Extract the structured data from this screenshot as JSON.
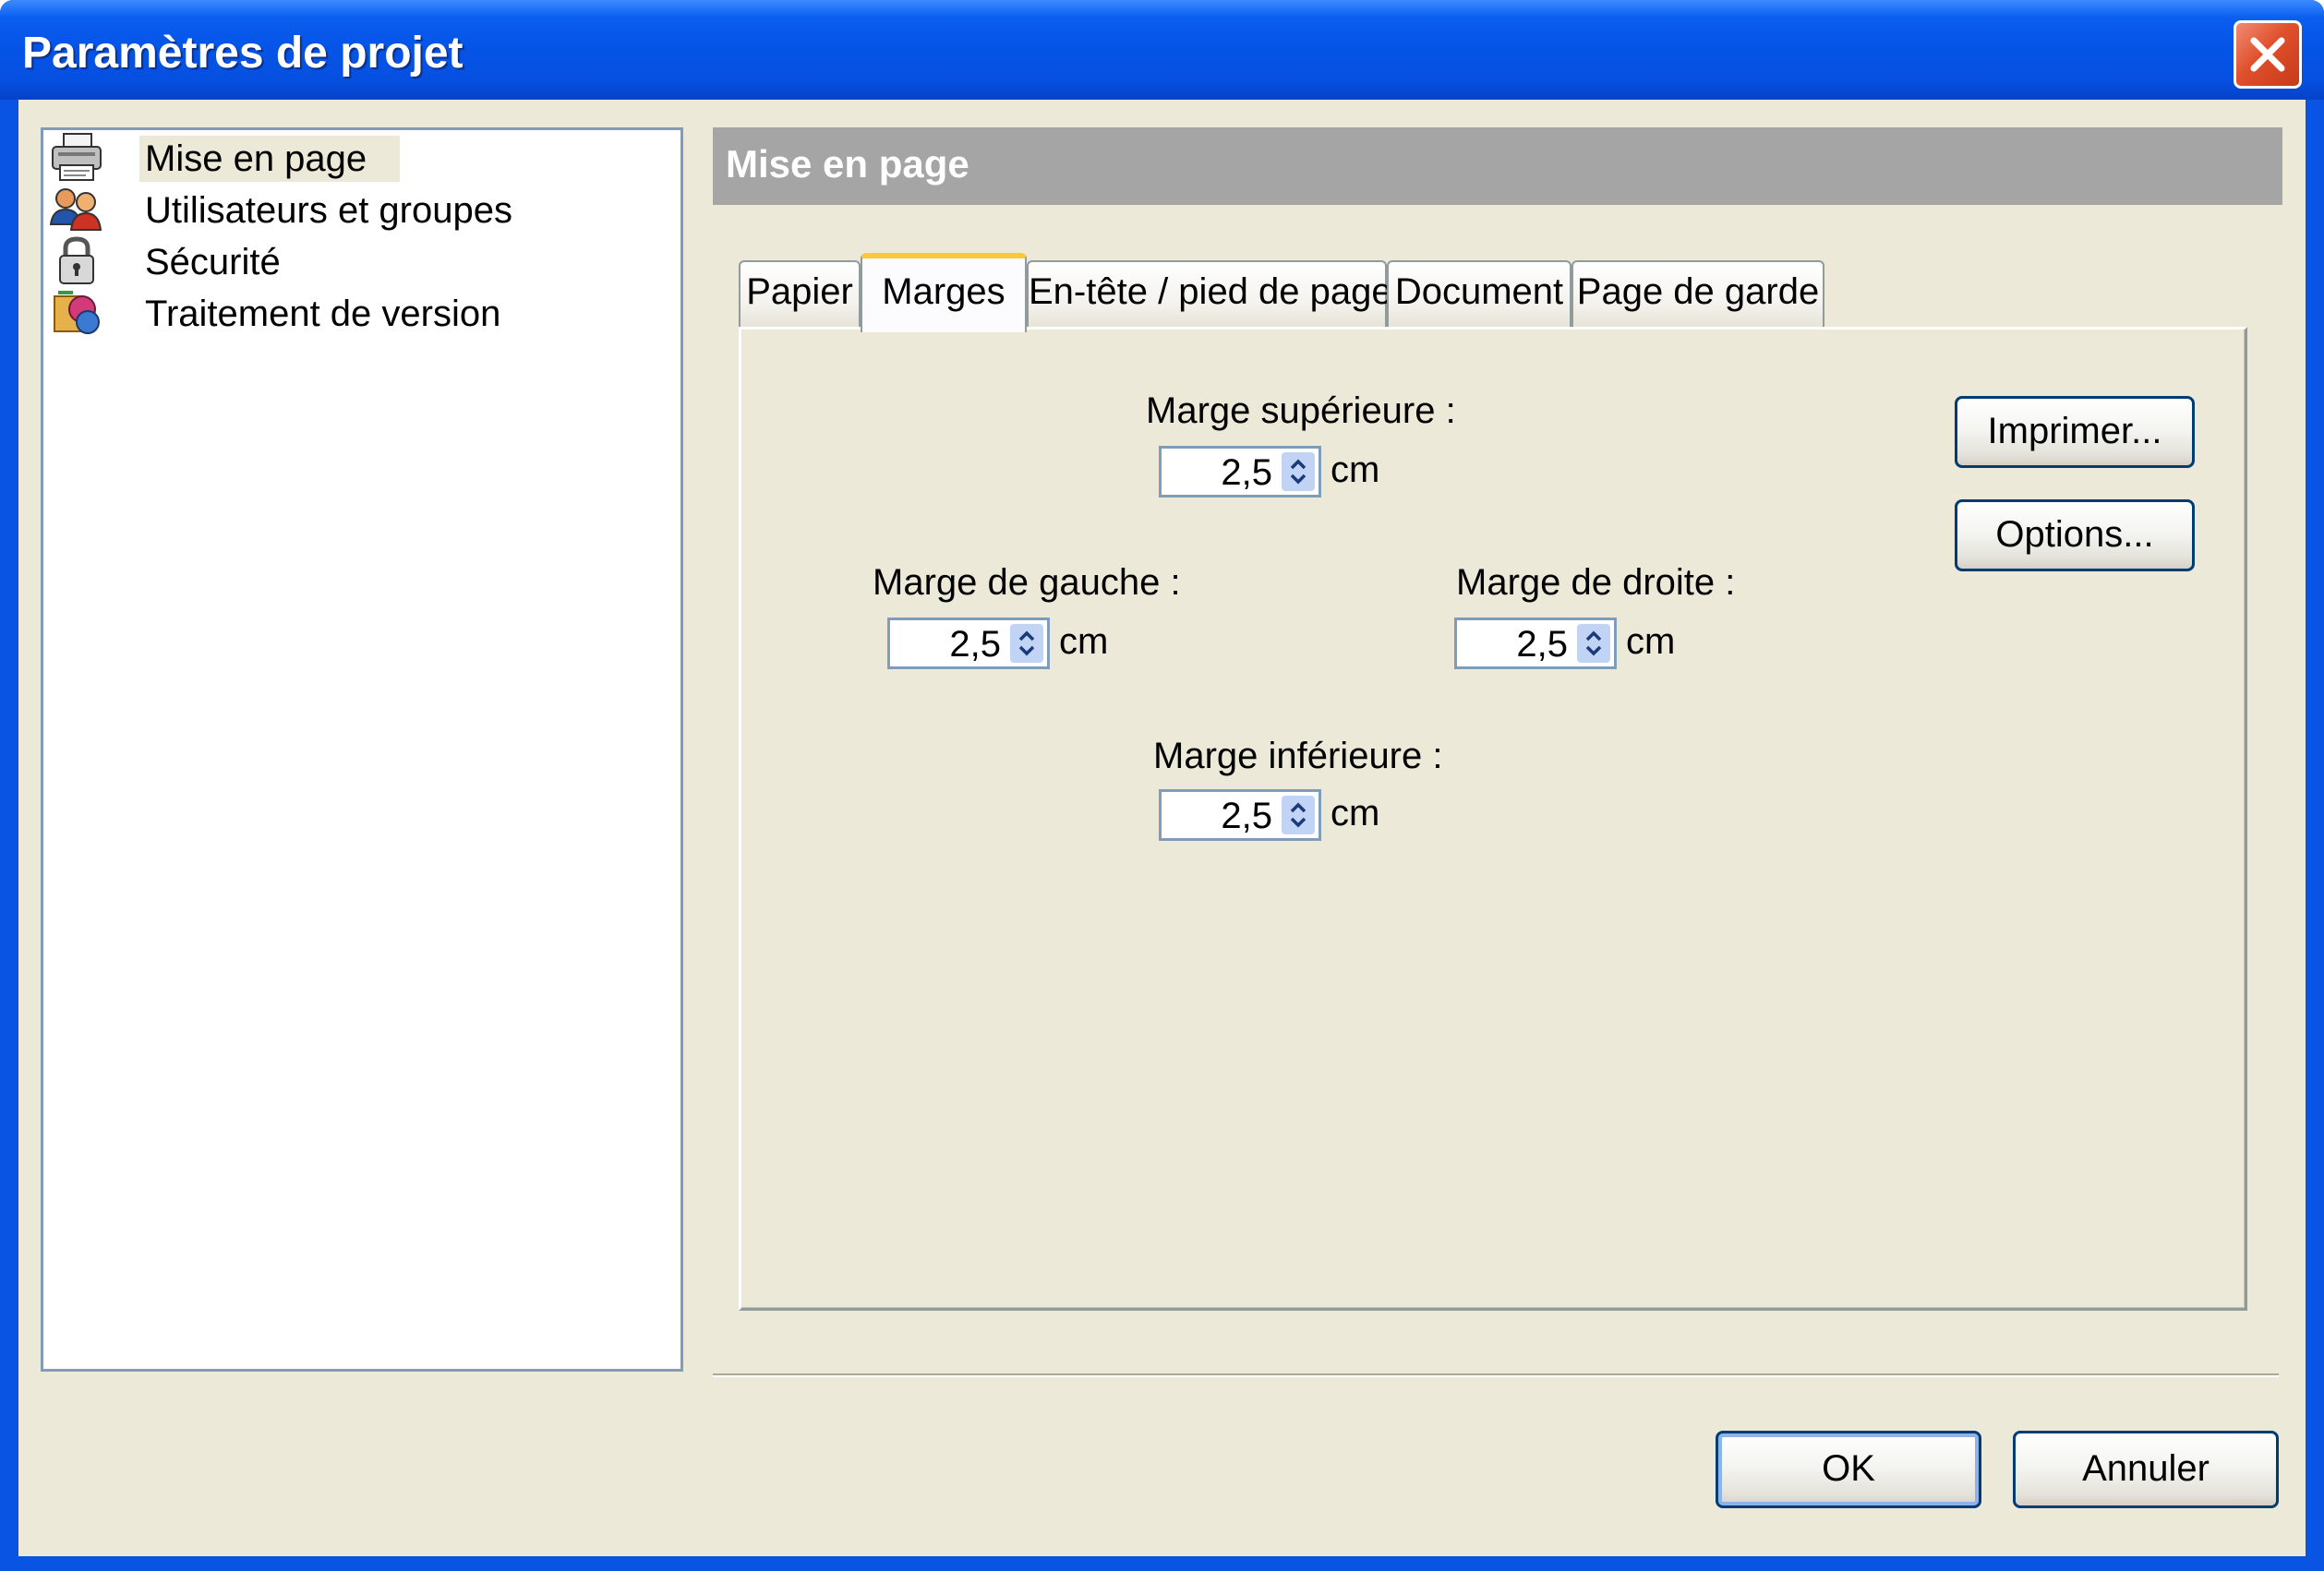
{
  "window": {
    "title": "Paramètres de projet"
  },
  "sidebar": {
    "items": [
      {
        "label": "Mise en page",
        "icon": "printer-icon",
        "selected": true
      },
      {
        "label": "Utilisateurs et groupes",
        "icon": "users-icon",
        "selected": false
      },
      {
        "label": "Sécurité",
        "icon": "padlock-icon",
        "selected": false
      },
      {
        "label": "Traitement de version",
        "icon": "version-processing-icon",
        "selected": false
      }
    ]
  },
  "panel": {
    "header": "Mise en page",
    "tabs": [
      {
        "label": "Papier",
        "active": false
      },
      {
        "label": "Marges",
        "active": true
      },
      {
        "label": "En-tête / pied de page",
        "active": false
      },
      {
        "label": "Document",
        "active": false
      },
      {
        "label": "Page de garde",
        "active": false
      }
    ],
    "margins": {
      "top": {
        "label": "Marge supérieure :",
        "value": "2,5",
        "unit": "cm"
      },
      "left": {
        "label": "Marge de gauche :",
        "value": "2,5",
        "unit": "cm"
      },
      "right": {
        "label": "Marge de droite :",
        "value": "2,5",
        "unit": "cm"
      },
      "bottom": {
        "label": "Marge inférieure :",
        "value": "2,5",
        "unit": "cm"
      }
    },
    "buttons": {
      "print": "Imprimer...",
      "options": "Options..."
    }
  },
  "footer": {
    "ok": "OK",
    "cancel": "Annuler"
  },
  "colors": {
    "titlebar": "#0555e8",
    "dialog_bg": "#ece9d8",
    "active_tab_accent": "#ffc73c",
    "header_bar": "#a5a5a5"
  }
}
